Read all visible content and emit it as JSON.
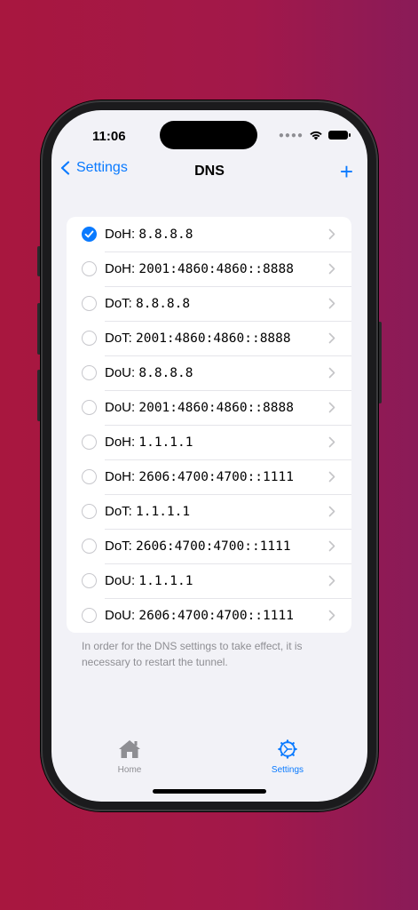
{
  "status": {
    "time": "11:06"
  },
  "nav": {
    "back_label": "Settings",
    "title": "DNS",
    "add_label": "+"
  },
  "dns_list": [
    {
      "proto": "DoH:",
      "addr": "8.8.8.8",
      "checked": true
    },
    {
      "proto": "DoH:",
      "addr": "2001:4860:4860::8888",
      "checked": false
    },
    {
      "proto": "DoT:",
      "addr": "8.8.8.8",
      "checked": false
    },
    {
      "proto": "DoT:",
      "addr": "2001:4860:4860::8888",
      "checked": false
    },
    {
      "proto": "DoU:",
      "addr": "8.8.8.8",
      "checked": false
    },
    {
      "proto": "DoU:",
      "addr": "2001:4860:4860::8888",
      "checked": false
    },
    {
      "proto": "DoH:",
      "addr": "1.1.1.1",
      "checked": false
    },
    {
      "proto": "DoH:",
      "addr": "2606:4700:4700::1111",
      "checked": false
    },
    {
      "proto": "DoT:",
      "addr": "1.1.1.1",
      "checked": false
    },
    {
      "proto": "DoT:",
      "addr": "2606:4700:4700::1111",
      "checked": false
    },
    {
      "proto": "DoU:",
      "addr": "1.1.1.1",
      "checked": false
    },
    {
      "proto": "DoU:",
      "addr": "2606:4700:4700::1111",
      "checked": false
    }
  ],
  "footer_note": "In order for the DNS settings to take effect, it is necessary to restart the tunnel.",
  "tabs": [
    {
      "label": "Home",
      "icon": "house-icon",
      "active": false
    },
    {
      "label": "Settings",
      "icon": "gear-icon",
      "active": true
    }
  ],
  "colors": {
    "accent": "#0a7aff",
    "background_left": "#a8173f",
    "background_right": "#8a1b58"
  }
}
